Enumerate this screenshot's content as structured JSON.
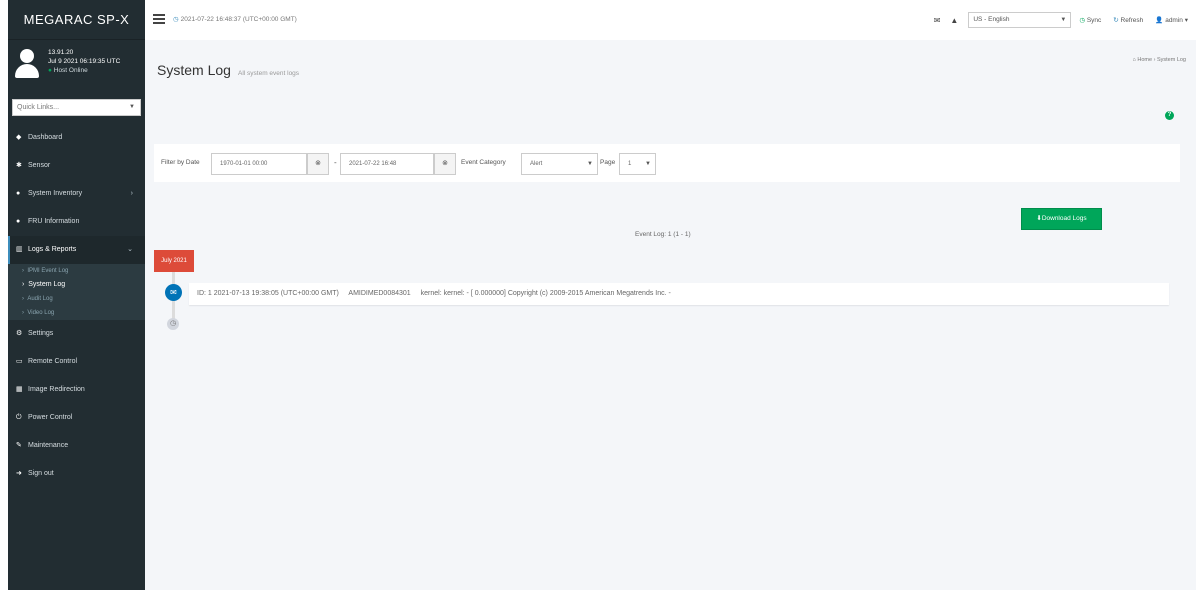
{
  "brand": "MEGARAC SP-X",
  "user": {
    "name": "13.91.20",
    "timestamp": "Jul 9 2021 06:19:35 UTC",
    "status": "Host Online"
  },
  "quicklinks": {
    "placeholder": "Quick Links..."
  },
  "sidebar": {
    "items": [
      {
        "label": "Dashboard",
        "icon": "dashboard-icon"
      },
      {
        "label": "Sensor",
        "icon": "sensor-icon"
      },
      {
        "label": "System Inventory",
        "icon": "inventory-icon"
      },
      {
        "label": "FRU Information",
        "icon": "fru-icon"
      },
      {
        "label": "Logs & Reports",
        "icon": "chart-icon"
      },
      {
        "label": "Settings",
        "icon": "settings-icon"
      },
      {
        "label": "Remote Control",
        "icon": "monitor-icon"
      },
      {
        "label": "Image Redirection",
        "icon": "image-icon"
      },
      {
        "label": "Power Control",
        "icon": "power-icon"
      },
      {
        "label": "Maintenance",
        "icon": "wrench-icon"
      },
      {
        "label": "Sign out",
        "icon": "signout-icon"
      }
    ],
    "logs_sub": [
      {
        "label": "IPMI Event Log"
      },
      {
        "label": "System Log"
      },
      {
        "label": "Audit Log"
      },
      {
        "label": "Video Log"
      }
    ]
  },
  "topbar": {
    "datetime": "2021-07-22 16:48:37 (UTC+00:00 GMT)",
    "language": "US - English",
    "sync": "Sync",
    "refresh": "Refresh",
    "user": "admin"
  },
  "page": {
    "title": "System Log",
    "subtitle": "All system event logs",
    "breadcrumb_home": "Home",
    "breadcrumb_current": "System Log"
  },
  "filter": {
    "label": "Filter by Date",
    "start_date": "1970-01-01 00:00",
    "end_date": "2021-07-22 16:48",
    "category_label": "Event Category",
    "category_value": "Alert",
    "page_label": "Page",
    "page_value": "1"
  },
  "download_label": "Download Logs",
  "event_count": "Event Log: 1 (1 - 1)",
  "timeline": {
    "month": "July 2021",
    "entries": [
      {
        "id": "ID: 1",
        "timestamp": "2021-07-13 19:38:05 (UTC+00:00 GMT)",
        "host": "AMIDIMED0084301",
        "source": "kernel: kernel: -",
        "message": "[ 0.000000] Copyright (c) 2009-2015 American Megatrends Inc. -"
      }
    ]
  },
  "colors": {
    "sidebar_bg": "#222d32",
    "accent_green": "#00a65a",
    "accent_blue": "#0073b7",
    "month_red": "#dd4b39"
  }
}
